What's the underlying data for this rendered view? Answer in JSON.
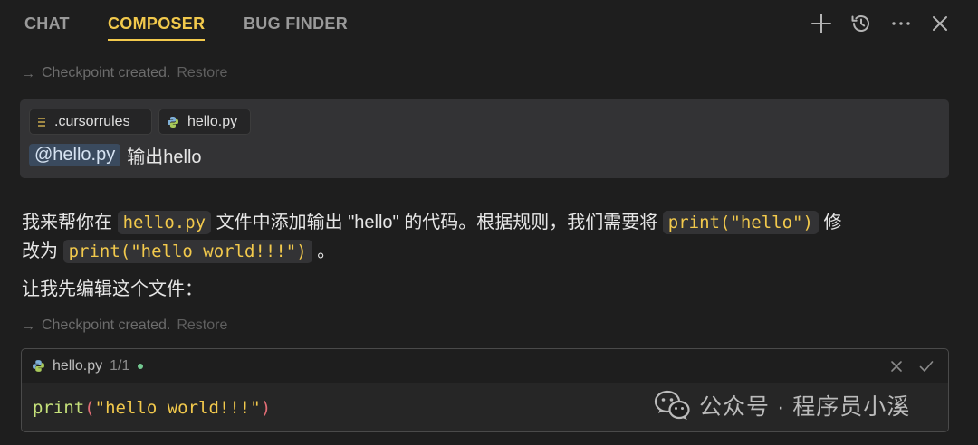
{
  "tabs": [
    {
      "label": "CHAT",
      "active": false
    },
    {
      "label": "COMPOSER",
      "active": true
    },
    {
      "label": "BUG FINDER",
      "active": false
    }
  ],
  "toolbar_icons": [
    "plus-icon",
    "history-icon",
    "more-icon",
    "close-icon"
  ],
  "checkpoints": [
    {
      "text": "Checkpoint created.",
      "action": "Restore"
    },
    {
      "text": "Checkpoint created.",
      "action": "Restore"
    }
  ],
  "user_message": {
    "context_chips": [
      {
        "label": ".cursorrules",
        "icon": "file-lines-icon"
      },
      {
        "label": "hello.py",
        "icon": "python-icon"
      }
    ],
    "mention": "@hello.py",
    "text": "输出hello"
  },
  "assistant": {
    "line1_a": "我来帮你在",
    "line1_code1": "hello.py",
    "line1_b": "文件中添加输出 \"hello\" 的代码。根据规则，我们需要将",
    "line1_code2": "print(\"hello\")",
    "line1_c": "修",
    "line2_a": "改为",
    "line2_code": "print(\"hello world!!!\")",
    "line2_b": "。",
    "line3": "让我先编辑这个文件："
  },
  "code_block": {
    "filename": "hello.py",
    "count": "1/1",
    "status_color": "#73c991",
    "code_fn": "print",
    "code_open": "(",
    "code_str": "\"hello world!!!\"",
    "code_close": ")"
  },
  "watermark": {
    "text": "公众号 · 程序员小溪"
  },
  "colors": {
    "background": "#1e1e1e",
    "accent": "#f2c94c",
    "panel": "#333335"
  }
}
